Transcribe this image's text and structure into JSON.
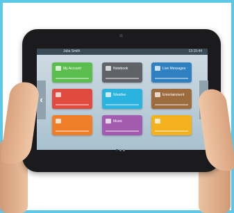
{
  "screen": {
    "status_title": "Julia Smith",
    "status_time": "13:15:44"
  },
  "tiles": [
    {
      "label": "My Account",
      "color": "#5bbd4e",
      "icon": "person-icon"
    },
    {
      "label": "Notebook",
      "color": "#5f6368",
      "icon": "notebook-icon"
    },
    {
      "label": "Live Messages",
      "color": "#2f7fc1",
      "icon": "chat-icon"
    },
    {
      "label": "",
      "color": "#e04a3f",
      "icon": "tile-icon"
    },
    {
      "label": "Weather",
      "color": "#2bb3e0",
      "icon": "cloud-icon"
    },
    {
      "label": "Entertainment",
      "color": "#9c6b3e",
      "icon": "film-icon"
    },
    {
      "label": "",
      "color": "#f07e28",
      "icon": "tile-icon"
    },
    {
      "label": "Music",
      "color": "#a35bb0",
      "icon": "music-icon"
    },
    {
      "label": "",
      "color": "#f2b11d",
      "icon": "tile-icon"
    }
  ],
  "colors": {
    "frame_border": "#5cc7e6",
    "tablet_body": "#1b1b1d"
  }
}
